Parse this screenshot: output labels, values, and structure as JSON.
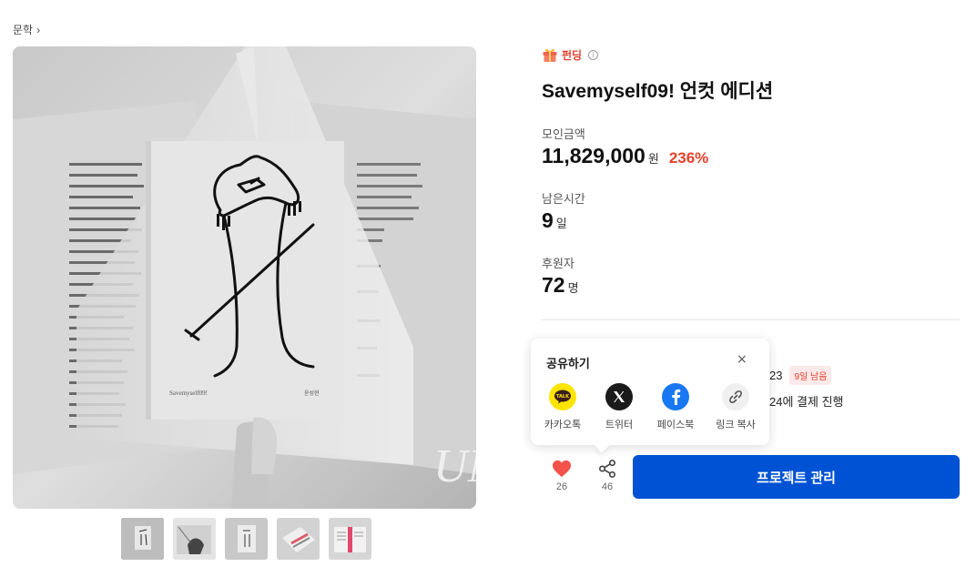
{
  "breadcrumb": {
    "category": "문학"
  },
  "project": {
    "funding_label": "펀딩",
    "title": "Savemyself09! 언컷 에디션"
  },
  "stats": {
    "raised_label": "모인금액",
    "raised_value": "11,829,000",
    "raised_unit": "원",
    "raised_percent": "236%",
    "remaining_label": "남은시간",
    "remaining_value": "9",
    "remaining_unit": "일",
    "backers_label": "후원자",
    "backers_value": "72",
    "backers_unit": "명"
  },
  "schedule": {
    "date_partial": "23",
    "days_left_badge": "9일 남음",
    "payment_partial": "24에 결제 진행"
  },
  "actions": {
    "like_count": "26",
    "share_count": "46",
    "manage_label": "프로젝트 관리"
  },
  "share_popup": {
    "title": "공유하기",
    "close": "×",
    "items": [
      {
        "label": "카카오톡",
        "icon": "kakaotalk-icon",
        "color": "#FEE500"
      },
      {
        "label": "트위터",
        "icon": "x-twitter-icon",
        "color": "#1a1a1a"
      },
      {
        "label": "페이스북",
        "icon": "facebook-icon",
        "color": "#1877F2"
      },
      {
        "label": "링크 복사",
        "icon": "link-icon",
        "color": "#f0f0f0"
      }
    ]
  },
  "book": {
    "cover_title": "Savemyself09!",
    "cover_author": "윤성현",
    "side_text": "UN"
  },
  "colors": {
    "accent": "#e3412c",
    "primary_button": "#0052d4",
    "heart": "#f2524a"
  }
}
